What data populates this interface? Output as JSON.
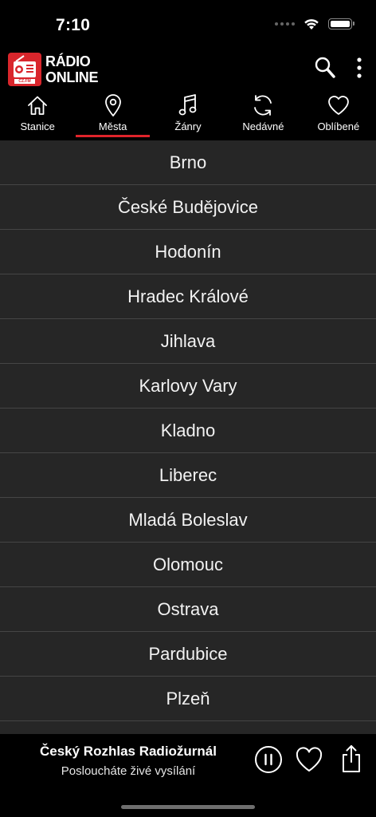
{
  "status_bar": {
    "time": "7:10"
  },
  "header": {
    "logo": {
      "line1": "RÁDIO",
      "line2": "ONLINE",
      "badge": "CZ.FM"
    }
  },
  "tabs": [
    {
      "label": "Stanice",
      "icon": "home-icon",
      "active": false
    },
    {
      "label": "Města",
      "icon": "location-pin-icon",
      "active": true
    },
    {
      "label": "Žánry",
      "icon": "music-note-icon",
      "active": false
    },
    {
      "label": "Nedávné",
      "icon": "refresh-icon",
      "active": false
    },
    {
      "label": "Oblíbené",
      "icon": "heart-icon",
      "active": false
    }
  ],
  "cities": [
    "Brno",
    "České Budějovice",
    "Hodonín",
    "Hradec Králové",
    "Jihlava",
    "Karlovy Vary",
    "Kladno",
    "Liberec",
    "Mladá Boleslav",
    "Olomouc",
    "Ostrava",
    "Pardubice",
    "Plzeň",
    ""
  ],
  "now_playing": {
    "station": "Český Rozhlas Radiožurnál",
    "status": "Posloucháte živé vysílání"
  },
  "colors": {
    "accent": "#e0242b",
    "list_bg": "#262626",
    "divider": "#454545"
  }
}
